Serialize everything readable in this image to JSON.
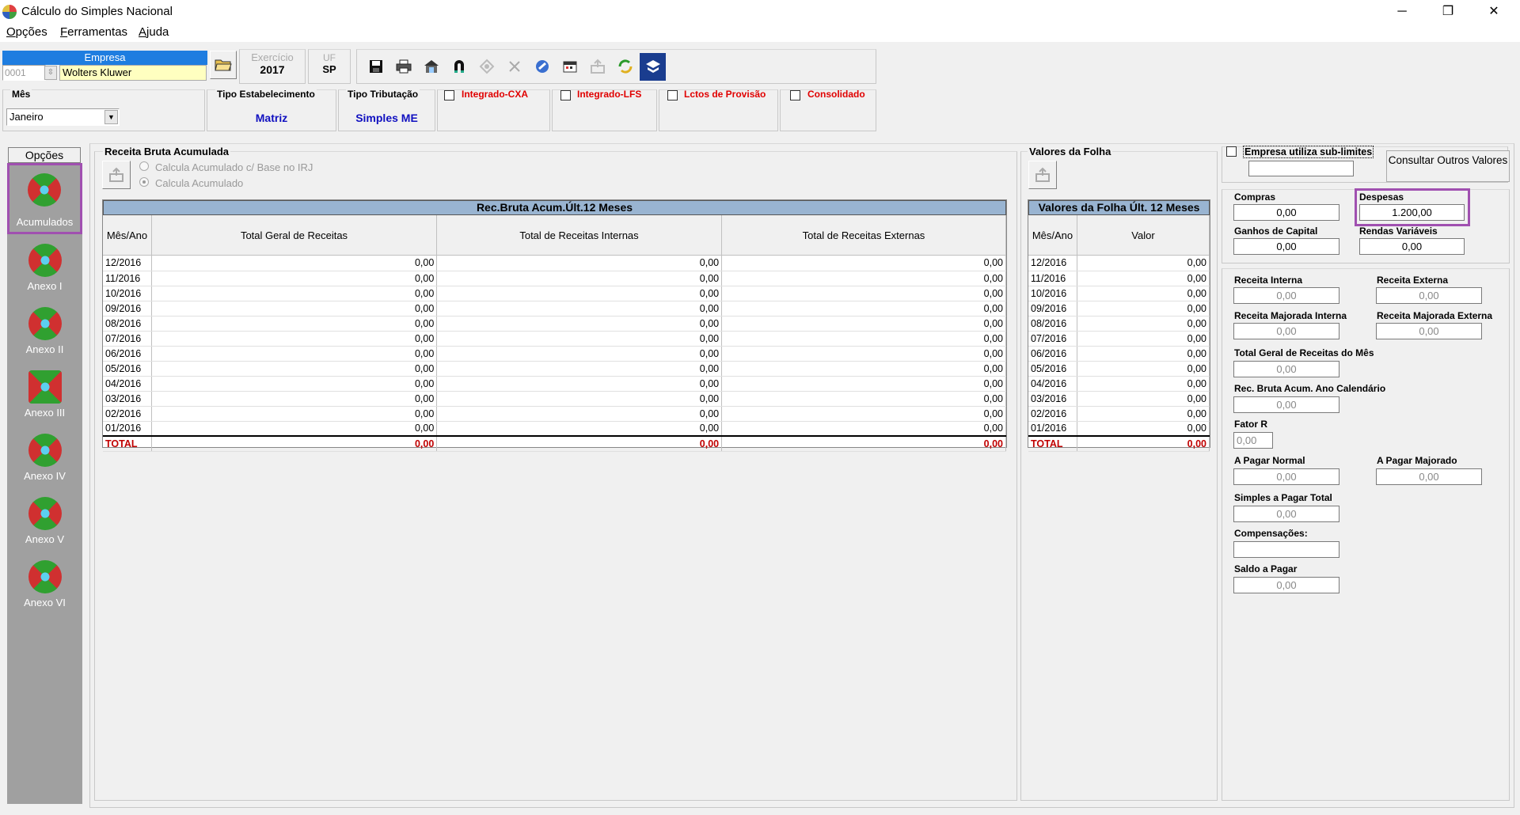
{
  "window": {
    "title": "Cálculo do Simples Nacional",
    "minimize": "─",
    "maximize": "❐",
    "close": "✕"
  },
  "menu": [
    {
      "label": "Opções",
      "underline": "O",
      "rest": "pções"
    },
    {
      "label": "Ferramentas",
      "underline": "F",
      "rest": "erramentas"
    },
    {
      "label": "Ajuda",
      "underline": "A",
      "rest": "juda"
    }
  ],
  "empresa": {
    "header": "Empresa",
    "code": "0001",
    "name": "Wolters Kluwer"
  },
  "exercicio": {
    "label": "Exercício",
    "value": "2017"
  },
  "uf": {
    "label": "UF",
    "value": "SP"
  },
  "mes": {
    "label": "Mês",
    "value": "Janeiro"
  },
  "tipo_estabelecimento": {
    "label": "Tipo Estabelecimento",
    "value": "Matriz"
  },
  "tipo_tributacao": {
    "label": "Tipo Tributação",
    "value": "Simples ME"
  },
  "checks": {
    "integrado_cxa": "Integrado-CXA",
    "integrado_lfs": "Integrado-LFS",
    "lctos_provisao": "Lctos de Provisão",
    "consolidado": "Consolidado"
  },
  "sidebar": {
    "title": "Opções",
    "items": [
      "Acumulados",
      "Anexo I",
      "Anexo II",
      "Anexo III",
      "Anexo IV",
      "Anexo V",
      "Anexo VI"
    ]
  },
  "receita": {
    "group_title": "Receita Bruta Acumulada",
    "radio1": "Calcula Acumulado c/ Base no IRJ",
    "radio2": "Calcula Acumulado",
    "grid_title": "Rec.Bruta Acum.Últ.12 Meses",
    "columns": [
      "Mês/Ano",
      "Total Geral de Receitas",
      "Total de Receitas Internas",
      "Total de Receitas Externas"
    ],
    "rows": [
      [
        "12/2016",
        "0,00",
        "0,00",
        "0,00"
      ],
      [
        "11/2016",
        "0,00",
        "0,00",
        "0,00"
      ],
      [
        "10/2016",
        "0,00",
        "0,00",
        "0,00"
      ],
      [
        "09/2016",
        "0,00",
        "0,00",
        "0,00"
      ],
      [
        "08/2016",
        "0,00",
        "0,00",
        "0,00"
      ],
      [
        "07/2016",
        "0,00",
        "0,00",
        "0,00"
      ],
      [
        "06/2016",
        "0,00",
        "0,00",
        "0,00"
      ],
      [
        "05/2016",
        "0,00",
        "0,00",
        "0,00"
      ],
      [
        "04/2016",
        "0,00",
        "0,00",
        "0,00"
      ],
      [
        "03/2016",
        "0,00",
        "0,00",
        "0,00"
      ],
      [
        "02/2016",
        "0,00",
        "0,00",
        "0,00"
      ],
      [
        "01/2016",
        "0,00",
        "0,00",
        "0,00"
      ]
    ],
    "total": [
      "TOTAL",
      "0,00",
      "0,00",
      "0,00"
    ]
  },
  "folha": {
    "group_title": "Valores da Folha",
    "grid_title": "Valores da Folha Últ. 12 Meses",
    "columns": [
      "Mês/Ano",
      "Valor"
    ],
    "rows": [
      [
        "12/2016",
        "0,00"
      ],
      [
        "11/2016",
        "0,00"
      ],
      [
        "10/2016",
        "0,00"
      ],
      [
        "09/2016",
        "0,00"
      ],
      [
        "08/2016",
        "0,00"
      ],
      [
        "07/2016",
        "0,00"
      ],
      [
        "06/2016",
        "0,00"
      ],
      [
        "05/2016",
        "0,00"
      ],
      [
        "04/2016",
        "0,00"
      ],
      [
        "03/2016",
        "0,00"
      ],
      [
        "02/2016",
        "0,00"
      ],
      [
        "01/2016",
        "0,00"
      ]
    ],
    "total": [
      "TOTAL",
      "0,00"
    ]
  },
  "right": {
    "sublimites": "Empresa utiliza sub-limites",
    "consultar": "Consultar Outros Valores",
    "compras": {
      "label": "Compras",
      "value": "0,00"
    },
    "despesas": {
      "label": "Despesas",
      "value": "1.200,00"
    },
    "ganhos": {
      "label": "Ganhos de Capital",
      "value": "0,00"
    },
    "rendas": {
      "label": "Rendas Variáveis",
      "value": "0,00"
    },
    "receita_interna": {
      "label": "Receita Interna",
      "value": "0,00"
    },
    "receita_externa": {
      "label": "Receita Externa",
      "value": "0,00"
    },
    "rmaj_interna": {
      "label": "Receita Majorada Interna",
      "value": "0,00"
    },
    "rmaj_externa": {
      "label": "Receita Majorada Externa",
      "value": "0,00"
    },
    "total_geral": {
      "label": "Total Geral de Receitas do Mês",
      "value": "0,00"
    },
    "rec_bruta_ano": {
      "label": "Rec. Bruta Acum. Ano Calendário",
      "value": "0,00"
    },
    "fator_r": {
      "label": "Fator R",
      "value": "0,00"
    },
    "a_pagar_normal": {
      "label": "A Pagar Normal",
      "value": "0,00"
    },
    "a_pagar_majorado": {
      "label": "A Pagar Majorado",
      "value": "0,00"
    },
    "simples_total": {
      "label": "Simples a Pagar Total",
      "value": "0,00"
    },
    "compensacoes": {
      "label": "Compensações:",
      "value": ""
    },
    "saldo": {
      "label": "Saldo a Pagar",
      "value": "0,00"
    }
  }
}
